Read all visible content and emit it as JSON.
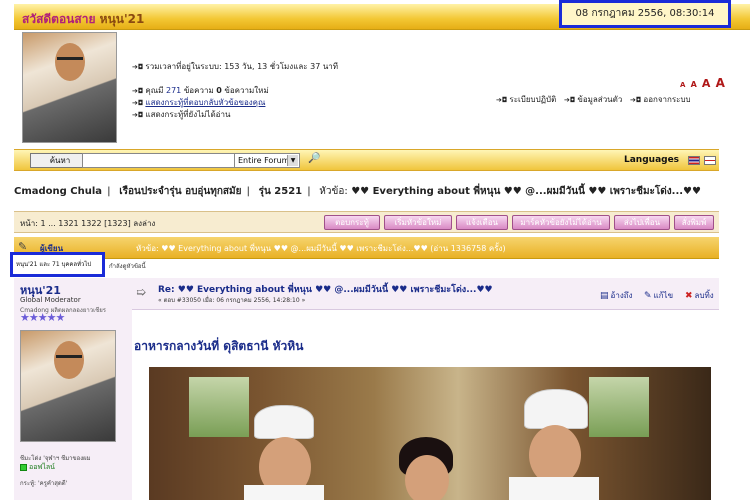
{
  "header": {
    "greeting": "สวัสดีตอนสาย",
    "username": "หนุน'21",
    "datetime": "08 กรกฎาคม 2556, 08:30:14"
  },
  "user_panel": {
    "online_time": "รวมเวลาที่อยู่ในระบบ: 153 วัน, 13 ชั่วโมงและ 37 นาที",
    "messages_prefix": "คุณมี",
    "messages_count": "271",
    "messages_mid": "ข้อความ",
    "messages_new": "0",
    "messages_suffix": "ข้อความใหม่",
    "link_replies": "แสดงกระทู้ที่ตอบกลับหัวข้อของคุณ",
    "link_unread": "แสดงกระทู้ที่ยังไม่ได้อ่าน",
    "link_rules": "ระเบียบปฏิบัติ",
    "link_profile": "ข้อมูลส่วนตัว",
    "link_logout": "ออกจากระบบ",
    "text_sizes": [
      "A",
      "A",
      "A",
      "A"
    ]
  },
  "search": {
    "button": "ค้นหา",
    "value": "",
    "scope": "Entire Forum",
    "languages_label": "Languages"
  },
  "breadcrumb": {
    "items": [
      "Cmadong Chula",
      "เรือนประจำรุ่น อบอุ่นทุกสมัย",
      "รุ่น 2521"
    ],
    "topic_prefix": "หัวข้อ:",
    "topic": "♥♥ Everything about พี่หนุน ♥♥ @...ผมมีวันนี้ ♥♥ เพราะชีมะโด่ง...♥♥"
  },
  "pager": {
    "text": "หน้า: 1 ... 1321 1322 [1323]   ลงล่าง",
    "buttons": [
      "ตอบกระทู้",
      "เริ่มหัวข้อใหม่",
      "แจ้งเตือน",
      "มาร์คหัวข้อยังไม่ได้อ่าน",
      "ส่งไปเพื่อน",
      "สั่งพิมพ์"
    ]
  },
  "thread_header": {
    "author_label": "ผู้เขียน",
    "topic_line": "หัวข้อ: ♥♥ Everything about พี่หนุน ♥♥ @...ผมมีวันนี้ ♥♥ เพราะชีมะโด่ง...♥♥  (อ่าน 1336758 ครั้ง)"
  },
  "online_box": {
    "text": "หนุน'21 และ 71 บุคคลทั่วไป",
    "rest": "กำลังดูหัวข้อนี้"
  },
  "author": {
    "name": "หนุน'21",
    "role": "Global Moderator",
    "group": "Cmadong ผลิตผลกลองยาวเชียร",
    "stars": "★★★★★",
    "signature": "ชีมะโด่ง 'จุฬาฯ ชีมาของผม",
    "status": "ออฟไลน์",
    "meta": "กระทู้: 'ครูคำสุดดี'"
  },
  "post": {
    "title": "Re: ♥♥ Everything about พี่หนุน ♥♥ @...ผมมีวันนี้ ♥♥ เพราะชีมะโด่ง...♥♥",
    "meta": "« ตอบ #33050 เมื่อ: 06 กรกฎาคม 2556, 14:28:10 »",
    "action_quote": "อ้างถึง",
    "action_edit": "แก้ไข",
    "action_delete": "ลบทิ้ง",
    "body_title": "อาหารกลางวันที่ ดุสิตธานี หัวหิน"
  },
  "colors": {
    "accent_yellow": "#f3c733",
    "link_blue": "#1a2c8a",
    "highlight_box": "#1a2bd8",
    "button_pink": "#d98ac4"
  }
}
